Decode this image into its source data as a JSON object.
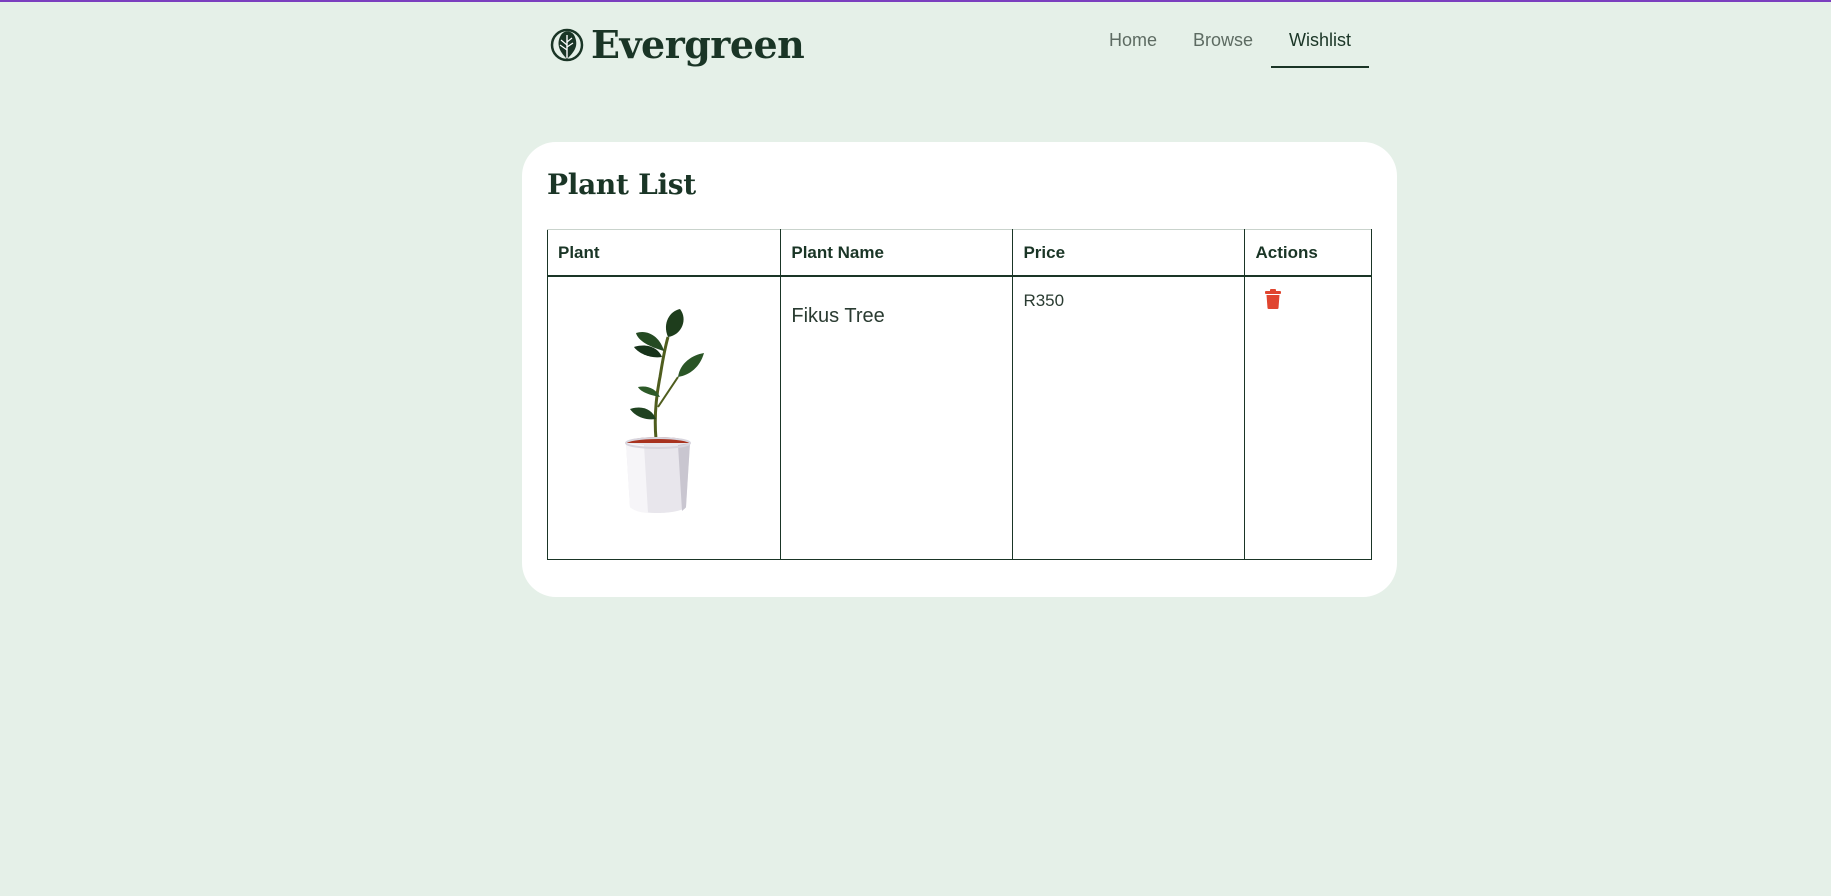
{
  "brand": {
    "name": "Evergreen",
    "logo_icon": "leaf-logo-icon"
  },
  "nav": {
    "items": [
      {
        "label": "Home",
        "active": false
      },
      {
        "label": "Browse",
        "active": false
      },
      {
        "label": "Wishlist",
        "active": true
      }
    ]
  },
  "wishlist": {
    "title": "Plant List",
    "columns": [
      "Plant",
      "Plant Name",
      "Price",
      "Actions"
    ],
    "rows": [
      {
        "plant_name": "Fikus Tree",
        "price": "R350",
        "image_icon": "potted-plant-image",
        "action_icon": "trash-icon"
      }
    ]
  },
  "colors": {
    "background": "#e5f0e8",
    "brand_text": "#1a3526",
    "accent_top_bar": "#7b3fbf",
    "delete": "#e0452f"
  }
}
